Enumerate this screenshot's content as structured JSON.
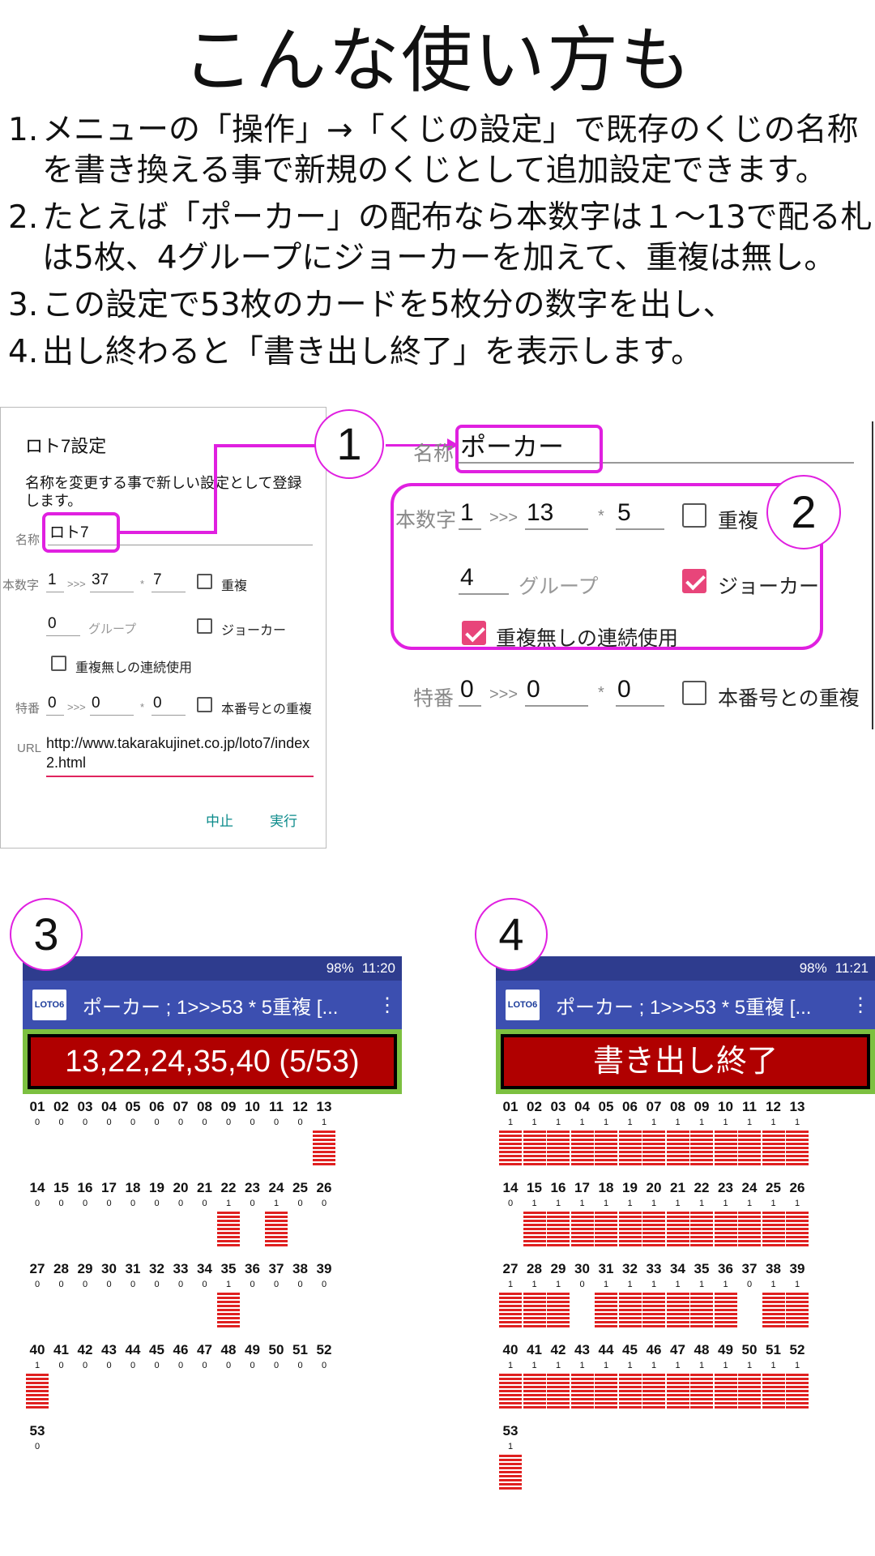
{
  "title": "こんな使い方も",
  "steps": [
    {
      "num": "1.",
      "text": "メニューの「操作」→「くじの設定」で既存のくじの名称を書き換える事で新規のくじとして追加設定できます。"
    },
    {
      "num": "2.",
      "text": "たとえば「ポーカー」の配布なら本数字は１〜13で配る札は5枚、4グループにジョーカーを加えて、重複は無し。"
    },
    {
      "num": "3.",
      "text": "この設定で53枚のカードを5枚分の数字を出し、"
    },
    {
      "num": "4.",
      "text": "出し終わると「書き出し終了」を表示します。"
    }
  ],
  "dialog": {
    "title": "ロト7設定",
    "description": "名称を変更する事で新しい設定として登録します。",
    "name_label": "名称",
    "name_value": "ロト7",
    "main_label": "本数字",
    "main_from": "1",
    "range_sep": ">>>",
    "main_to": "37",
    "times_sep": "*",
    "main_count": "7",
    "dup_label": "重複",
    "group_value": "0",
    "group_label": "グループ",
    "joker_label": "ジョーカー",
    "nodup_label": "重複無しの連続使用",
    "special_label": "特番",
    "special_from": "0",
    "special_to": "0",
    "special_count": "0",
    "special_dup_label": "本番号との重複",
    "url_label": "URL",
    "url_value": "http://www.takarakujinet.co.jp/loto7/index2.html",
    "cancel_label": "中止",
    "run_label": "実行"
  },
  "zoom": {
    "name_label": "名称",
    "name_value": "ポーカー",
    "main_label": "本数字",
    "main_from": "1",
    "range_sep": ">>>",
    "main_to": "13",
    "times_sep": "*",
    "main_count": "5",
    "dup_label": "重複",
    "group_value": "4",
    "group_label": "グループ",
    "joker_label": "ジョーカー",
    "nodup_label": "重複無しの連続使用",
    "special_label": "特番",
    "special_from": "0",
    "special_to": "0",
    "special_count": "0",
    "special_dup_label": "本番号との重複"
  },
  "callouts": [
    "1",
    "2",
    "3",
    "4"
  ],
  "phone3": {
    "time": "11:20",
    "battery": "98%",
    "app_title": "ポーカー ; 1>>>53 * 5重複 [...",
    "logo": "LOTO6",
    "result": "13,22,24,35,40 (5/53)",
    "counts": [
      0,
      0,
      0,
      0,
      0,
      0,
      0,
      0,
      0,
      0,
      0,
      0,
      1,
      0,
      0,
      0,
      0,
      0,
      0,
      0,
      0,
      1,
      0,
      1,
      0,
      0,
      0,
      0,
      0,
      0,
      0,
      0,
      0,
      0,
      1,
      0,
      0,
      0,
      0,
      1,
      0,
      0,
      0,
      0,
      0,
      0,
      0,
      0,
      0,
      0,
      0,
      0,
      0
    ]
  },
  "phone4": {
    "time": "11:21",
    "battery": "98%",
    "app_title": "ポーカー ; 1>>>53 * 5重複 [...",
    "logo": "LOTO6",
    "result": "書き出し終了",
    "counts": [
      1,
      1,
      1,
      1,
      1,
      1,
      1,
      1,
      1,
      1,
      1,
      1,
      1,
      0,
      1,
      1,
      1,
      1,
      1,
      1,
      1,
      1,
      1,
      1,
      1,
      1,
      1,
      1,
      1,
      0,
      1,
      1,
      1,
      1,
      1,
      1,
      0,
      1,
      1,
      1,
      1,
      1,
      1,
      1,
      1,
      1,
      1,
      1,
      1,
      1,
      1,
      1,
      1
    ]
  },
  "colors": {
    "accent_magenta": "#e020e0",
    "checkbox_pink": "#e8457a",
    "appbar_blue": "#3c4fb0",
    "statusbar_blue": "#2e3c8e",
    "result_red": "#b00000",
    "result_frame_green": "#7cc040",
    "bar_red": "#e02020",
    "button_teal": "#0a8a8a"
  }
}
